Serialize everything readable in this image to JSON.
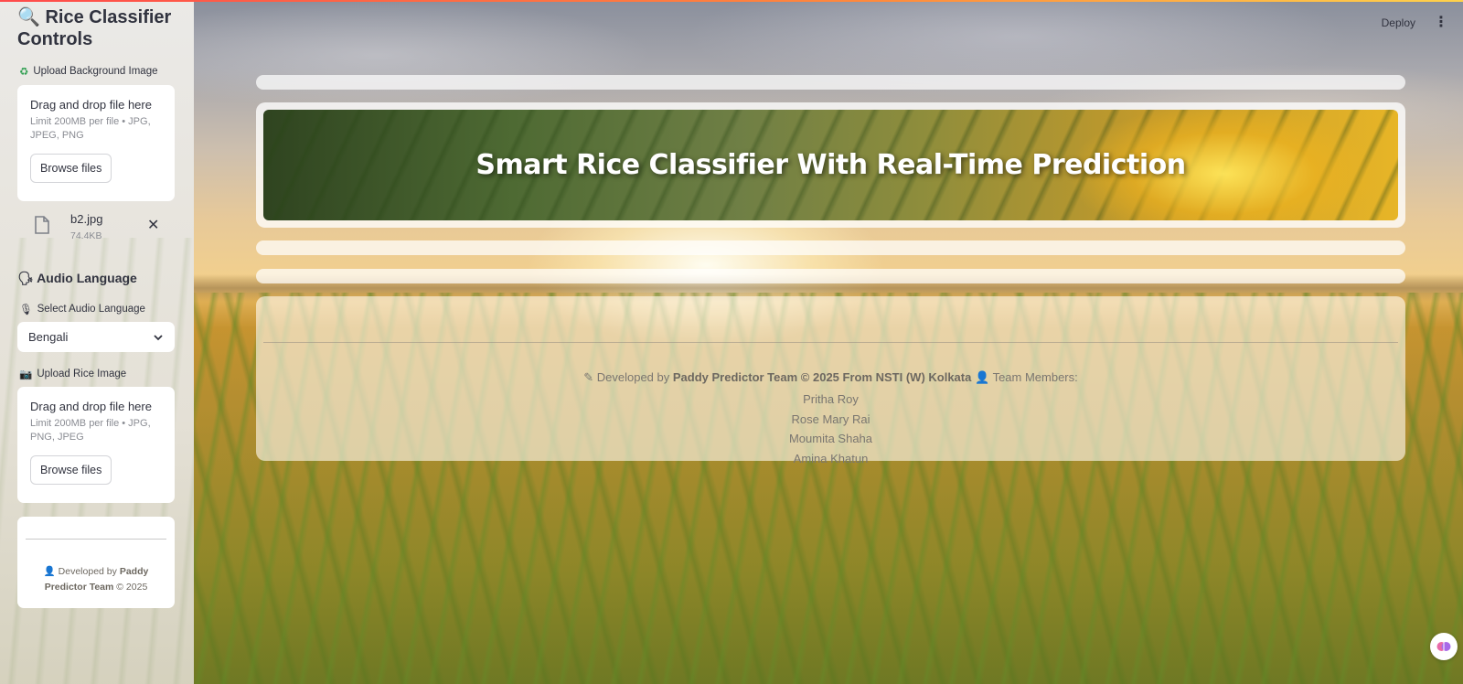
{
  "sidebar": {
    "title": "Rice Classifier Controls",
    "bg_upload_label": "Upload Background Image",
    "bg_uploader": {
      "dropzone_text": "Drag and drop file here",
      "limit_text": "Limit 200MB per file • JPG, JPEG, PNG",
      "browse_label": "Browse files"
    },
    "uploaded_file": {
      "name": "b2.jpg",
      "size": "74.4KB"
    },
    "audio_heading": "Audio Language",
    "select_audio_label": "Select Audio Language",
    "audio_language": "Bengali",
    "rice_upload_label": "Upload Rice Image",
    "rice_uploader": {
      "dropzone_text": "Drag and drop file here",
      "limit_text": "Limit 200MB per file • JPG, PNG, JPEG",
      "browse_label": "Browse files"
    },
    "footer": {
      "prefix": "Developed by",
      "team": "Paddy Predictor Team",
      "suffix": "© 2025"
    }
  },
  "header": {
    "deploy_label": "Deploy"
  },
  "main": {
    "hero_title": "Smart Rice Classifier With Real-Time Prediction",
    "footer": {
      "prefix": "Developed by",
      "team_bold": "Paddy Predictor Team © 2025 From NSTI (W) Kolkata",
      "members_label": "Team Members:",
      "members": [
        "Pritha Roy",
        "Rose Mary Rai",
        "Moumita Shaha",
        "Amina Khatun"
      ]
    }
  },
  "icons": {
    "title_icon": "magnifier-icon",
    "recycle": "recycle-icon",
    "speaker": "speaking-head-icon",
    "mic": "microphone-icon",
    "camera": "camera-icon",
    "pen": "pen-icon",
    "person": "person-icon"
  },
  "colors": {
    "accent_red": "#ff4b4b",
    "text": "#31333f"
  }
}
